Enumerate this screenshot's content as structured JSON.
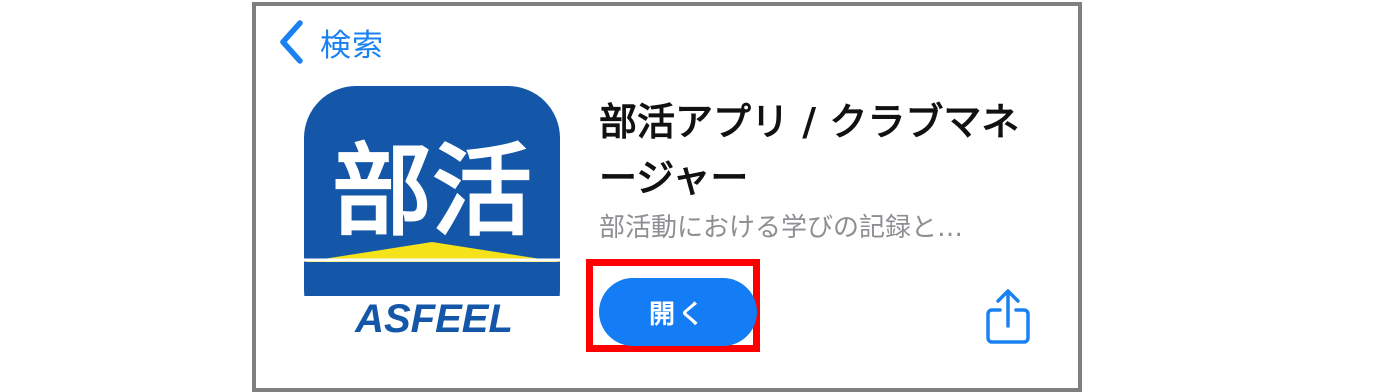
{
  "nav": {
    "back_label": "検索",
    "back_icon": "chevron-left-icon"
  },
  "app": {
    "icon": {
      "main_text": "部活",
      "brand_text": "ASFEEL",
      "colors": {
        "blue": "#1457a8",
        "yellow": "#f4e21b",
        "white": "#ffffff"
      }
    },
    "title": "部活アプリ / クラブマネージャー",
    "subtitle": "部活動における学びの記録と…",
    "open_label": "開く",
    "share_icon": "share-icon"
  },
  "colors": {
    "accent": "#1a82f0",
    "button": "#147cf5",
    "highlight": "#ff0000",
    "frame": "#7f7f7f",
    "subtitle": "#8e8e93"
  }
}
